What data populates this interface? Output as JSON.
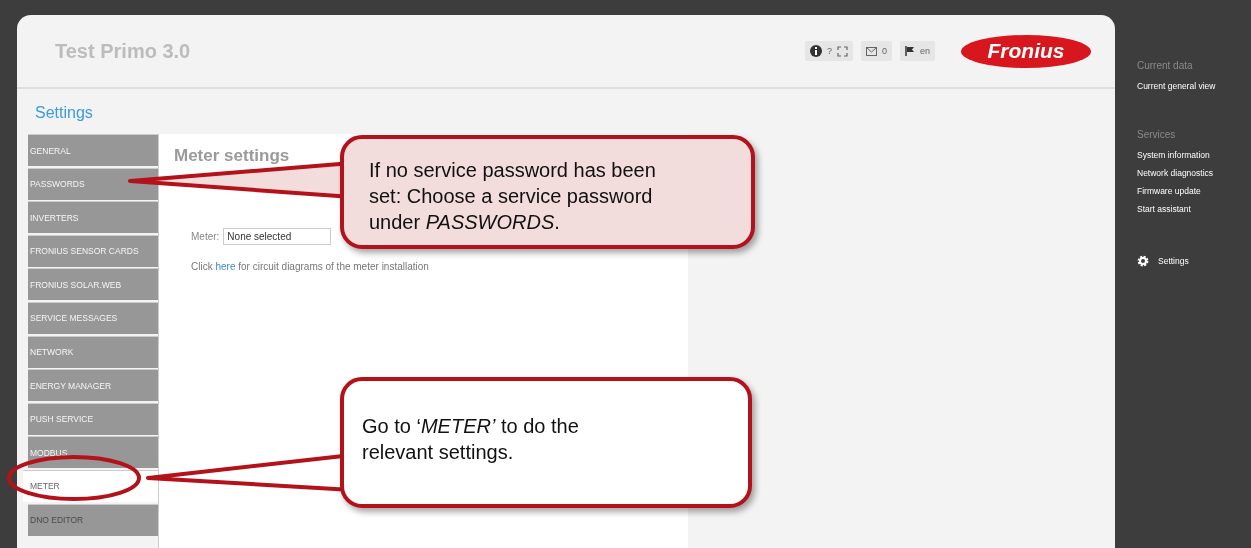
{
  "header": {
    "title": "Test Primo 3.0",
    "toolbar": [
      {
        "kind": "info"
      },
      {
        "kind": "text",
        "text": "?"
      },
      {
        "kind": "expand"
      },
      {
        "kind": "mail",
        "text": "0"
      },
      {
        "kind": "flag",
        "text": "en"
      }
    ],
    "logo": "Fronius"
  },
  "page_title": "Settings",
  "menu": [
    {
      "label": "GENERAL",
      "selected": false,
      "disabled": false
    },
    {
      "label": "PASSWORDS",
      "selected": false,
      "disabled": false
    },
    {
      "label": "INVERTERS",
      "selected": false,
      "disabled": false
    },
    {
      "label": "FRONIUS SENSOR CARDS",
      "selected": false,
      "disabled": false
    },
    {
      "label": "FRONIUS SOLAR.WEB",
      "selected": false,
      "disabled": false
    },
    {
      "label": "SERVICE MESSAGES",
      "selected": false,
      "disabled": false
    },
    {
      "label": "NETWORK",
      "selected": false,
      "disabled": false
    },
    {
      "label": "ENERGY MANAGER",
      "selected": false,
      "disabled": false
    },
    {
      "label": "PUSH SERVICE",
      "selected": false,
      "disabled": false
    },
    {
      "label": "MODBUS",
      "selected": false,
      "disabled": false
    },
    {
      "label": "METER",
      "selected": true,
      "disabled": false
    },
    {
      "label": "DNO EDITOR",
      "selected": false,
      "disabled": true
    }
  ],
  "content": {
    "heading": "Meter settings",
    "meter_label": "Meter:",
    "meter_value": "None selected",
    "link_prefix": "Click",
    "link": "here",
    "link_suffix": "for circuit diagrams of the meter installation"
  },
  "sidebar": {
    "sections": [
      {
        "heading": "Current data",
        "items": [
          "Current general view"
        ]
      },
      {
        "heading": "Services",
        "items": [
          "System information",
          "Network diagnostics",
          "Firmware update",
          "Start assistant"
        ]
      }
    ],
    "settings": "Settings"
  },
  "callouts": [
    {
      "kind": "pink",
      "text": "If no service password has been set: Choose a service password under *PASSWORDS*."
    },
    {
      "kind": "white",
      "text": "Go to ‘*METER’* to do the relevant settings."
    }
  ]
}
